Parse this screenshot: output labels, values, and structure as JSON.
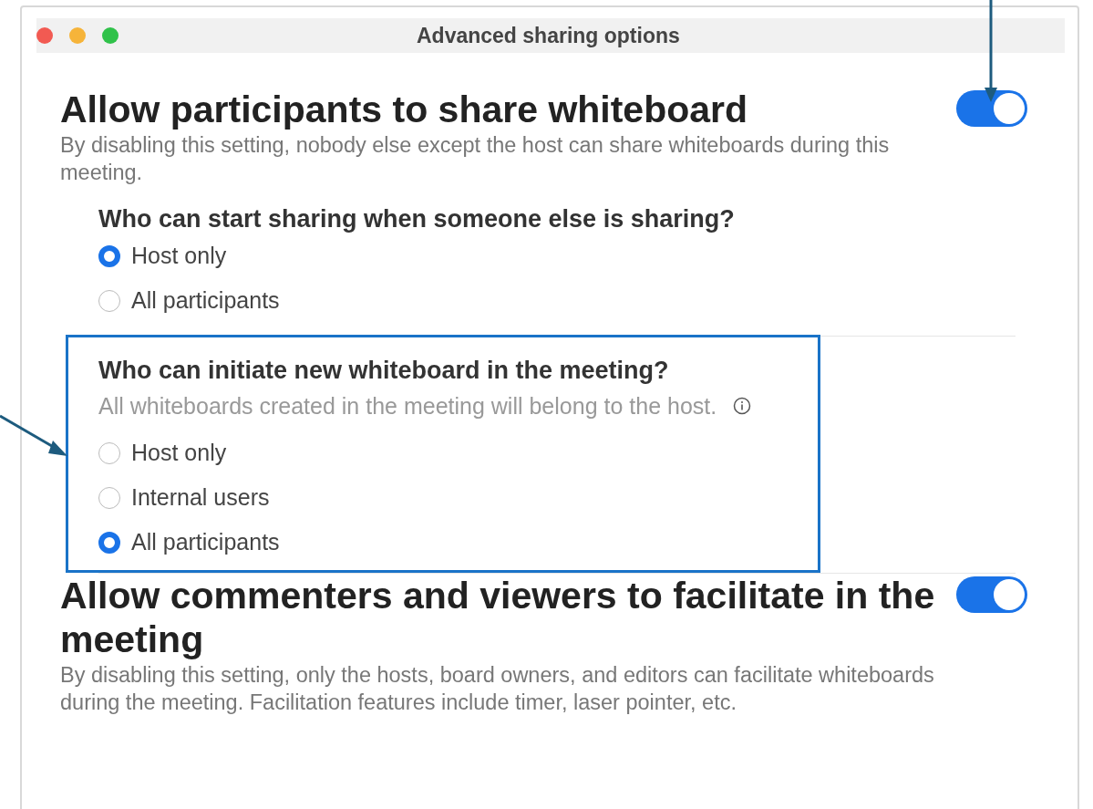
{
  "window": {
    "title": "Advanced sharing options"
  },
  "settings": [
    {
      "title": "Allow participants to share whiteboard",
      "on": true,
      "description": "By disabling this setting, nobody else except the host can share whiteboards during this meeting.",
      "questions": [
        {
          "question": "Who can start sharing when someone else is sharing?",
          "highlighted": false,
          "options": [
            {
              "label": "Host only",
              "selected": true
            },
            {
              "label": "All participants",
              "selected": false
            }
          ]
        },
        {
          "question": "Who can initiate new whiteboard in the meeting?",
          "note": "All whiteboards created in the meeting will belong to the host.",
          "highlighted": true,
          "options": [
            {
              "label": "Host only",
              "selected": false
            },
            {
              "label": "Internal users",
              "selected": false
            },
            {
              "label": "All participants",
              "selected": true
            }
          ]
        }
      ]
    },
    {
      "title": "Allow commenters and viewers to facilitate in the meeting",
      "on": true,
      "description": "By disabling this setting, only the hosts, board owners, and editors can facilitate whiteboards during the meeting. Facilitation features include timer, laser pointer, etc."
    }
  ]
}
